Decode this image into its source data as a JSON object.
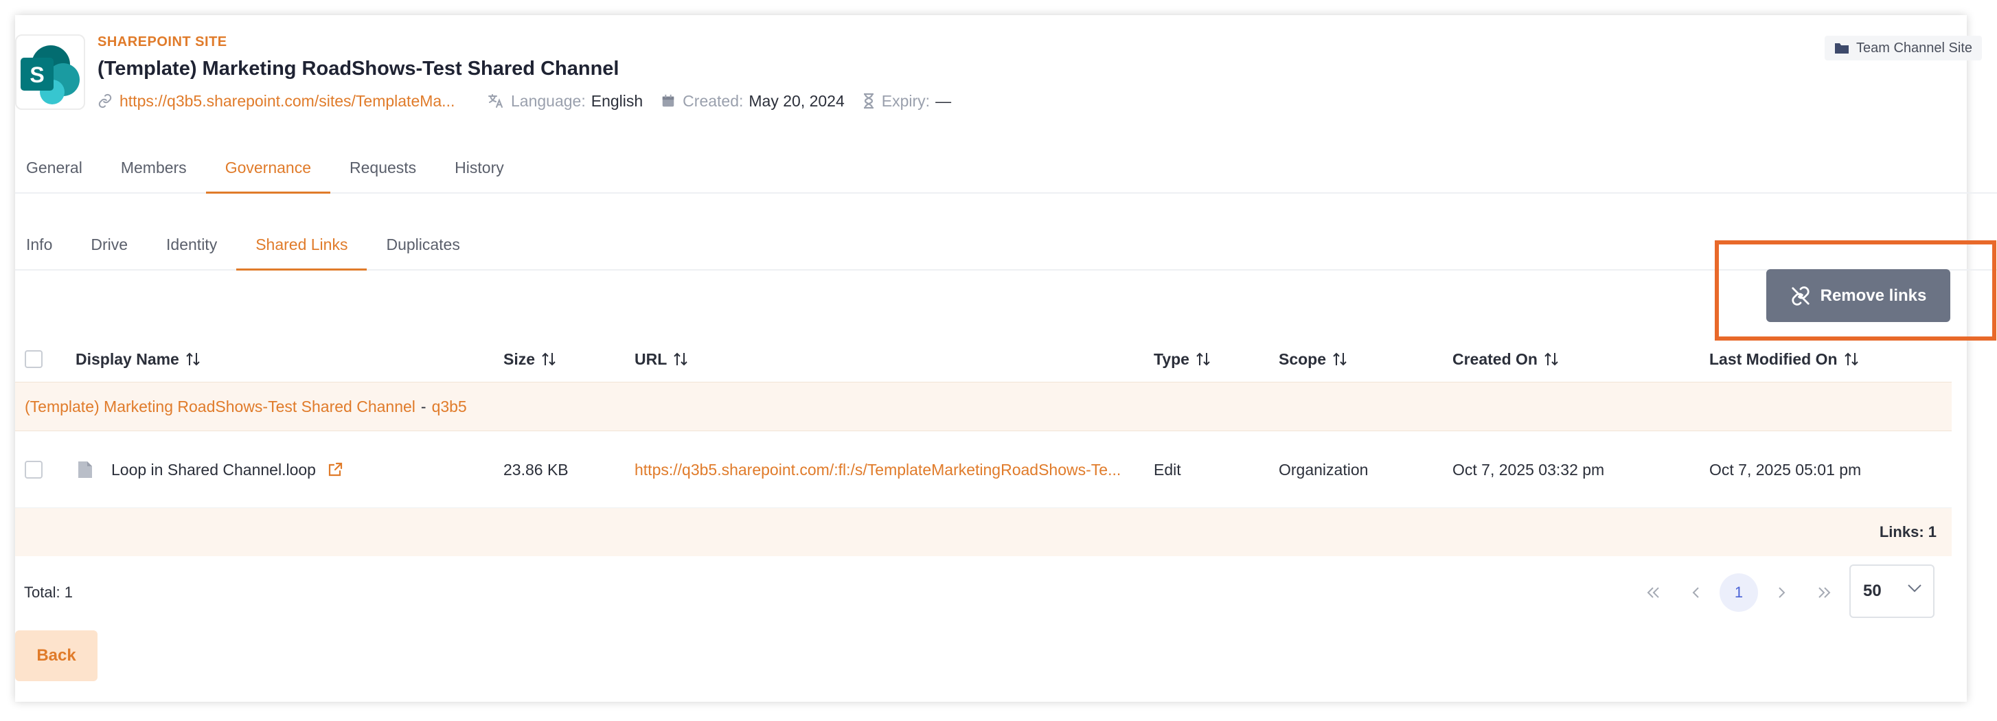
{
  "header": {
    "site_type_label": "SHAREPOINT SITE",
    "site_title": "(Template) Marketing RoadShows-Test Shared Channel",
    "site_url": "https://q3b5.sharepoint.com/sites/TemplateMa...",
    "language_label": "Language:",
    "language_value": "English",
    "created_label": "Created:",
    "created_value": "May 20, 2024",
    "expiry_label": "Expiry:",
    "expiry_value": "—",
    "badge": "Team Channel Site"
  },
  "tabs": [
    "General",
    "Members",
    "Governance",
    "Requests",
    "History"
  ],
  "active_tab": "Governance",
  "subtabs": [
    "Info",
    "Drive",
    "Identity",
    "Shared Links",
    "Duplicates"
  ],
  "active_subtab": "Shared Links",
  "actions": {
    "remove_links": "Remove links"
  },
  "table": {
    "columns": {
      "display_name": "Display Name",
      "size": "Size",
      "url": "URL",
      "type": "Type",
      "scope": "Scope",
      "created_on": "Created On",
      "last_modified_on": "Last Modified On"
    },
    "group": {
      "site": "(Template) Marketing RoadShows-Test Shared Channel",
      "separator": "-",
      "tenant": "q3b5"
    },
    "rows": [
      {
        "display_name": "Loop in Shared Channel.loop",
        "size": "23.86 KB",
        "url": "https://q3b5.sharepoint.com/:fl:/s/TemplateMarketingRoadShows-Te...",
        "type": "Edit",
        "scope": "Organization",
        "created_on": "Oct 7, 2025 03:32 pm",
        "last_modified_on": "Oct 7, 2025 05:01 pm"
      }
    ],
    "group_footer": "Links: 1"
  },
  "pagination": {
    "total": "Total: 1",
    "current_page": "1",
    "page_size": "50"
  },
  "back_label": "Back",
  "colors": {
    "accent": "#e07b2a",
    "button": "#6b7384",
    "highlight": "#e8692a",
    "row_tint": "#fdf5ee"
  }
}
